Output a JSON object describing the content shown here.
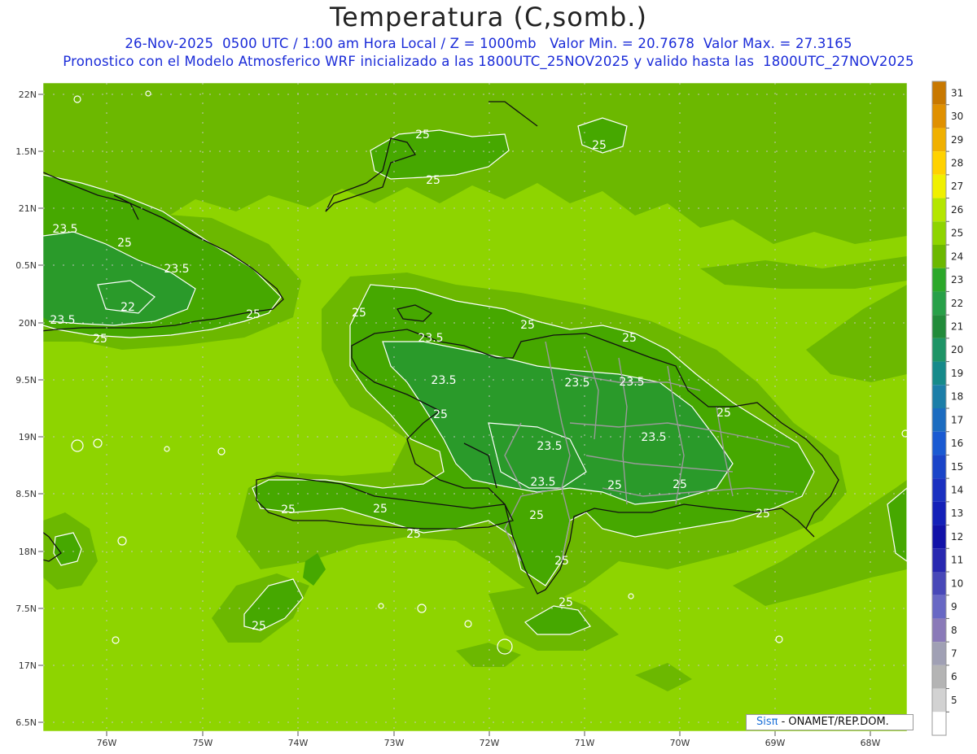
{
  "title": "Temperatura (C,somb.)",
  "subtitle_line1": "26-Nov-2025  0500 UTC / 1:00 am Hora Local / Z = 1000mb   Valor Min. = 20.7678  Valor Max. = 27.3165",
  "subtitle_line2": "Pronostico con el Modelo Atmosferico WRF inicializado a las 1800UTC_25NOV2025 y valido hasta las  1800UTC_27NOV2025",
  "credit": {
    "brand": "Sisπ",
    "text": " - ONAMET/REP.DOM."
  },
  "colors": {
    "background_fill": "#8ed400",
    "fill_25_26": "#6cb800",
    "fill_24_25": "#46a800",
    "fill_23_24": "#2a9a2a",
    "contour_line": "#ffffff",
    "coastline": "#111111",
    "province_border": "#9a9a9a",
    "title": "#222222",
    "subtitle": "#1a2bd8"
  },
  "axes": {
    "lat_labels": [
      "22N",
      "1.5N",
      "21N",
      "0.5N",
      "20N",
      "9.5N",
      "19N",
      "8.5N",
      "18N",
      "7.5N",
      "17N",
      "6.5N"
    ],
    "lon_labels": [
      "76W",
      "75W",
      "74W",
      "73W",
      "72W",
      "71W",
      "70W",
      "69W",
      "68W"
    ],
    "grid": "dotted"
  },
  "legend": {
    "labels": [
      "31",
      "30",
      "29",
      "28",
      "27",
      "26",
      "25",
      "24",
      "23",
      "22",
      "21",
      "20",
      "19",
      "18",
      "17",
      "16",
      "15",
      "14",
      "13",
      "12",
      "11",
      "10",
      "9",
      "8",
      "7",
      "6",
      "5"
    ],
    "colors": [
      "#c87800",
      "#e09000",
      "#f0b000",
      "#ffd200",
      "#f0f000",
      "#b4e600",
      "#8ed400",
      "#6cb800",
      "#2ca82a",
      "#28a048",
      "#228b3a",
      "#1e9466",
      "#168a8a",
      "#1c7ea8",
      "#1c6cc0",
      "#1a5ad2",
      "#1a44c8",
      "#1a30c0",
      "#1420b8",
      "#1212a8",
      "#2828b0",
      "#4848b8",
      "#6868c4",
      "#8a7ab8",
      "#a0a0b4",
      "#b4b4b4",
      "#d2d2d2",
      "#ffffff"
    ]
  },
  "contour_labels": [
    {
      "text": "25"
    },
    {
      "text": "25"
    },
    {
      "text": "25"
    },
    {
      "text": "23.5"
    },
    {
      "text": "25"
    },
    {
      "text": "23.5"
    },
    {
      "text": "22"
    },
    {
      "text": "23.5"
    },
    {
      "text": "25"
    },
    {
      "text": "25"
    },
    {
      "text": "25"
    },
    {
      "text": "23.5"
    },
    {
      "text": "25"
    },
    {
      "text": "25"
    },
    {
      "text": "23.5"
    },
    {
      "text": "23.5"
    },
    {
      "text": "23.5"
    },
    {
      "text": "25"
    },
    {
      "text": "23.5"
    },
    {
      "text": "25"
    },
    {
      "text": "23.5"
    },
    {
      "text": "23.5"
    },
    {
      "text": "25"
    },
    {
      "text": "25"
    },
    {
      "text": "25"
    },
    {
      "text": "25"
    },
    {
      "text": "25"
    },
    {
      "text": "25"
    },
    {
      "text": "25"
    },
    {
      "text": "25"
    },
    {
      "text": "25"
    },
    {
      "text": "25"
    }
  ]
}
